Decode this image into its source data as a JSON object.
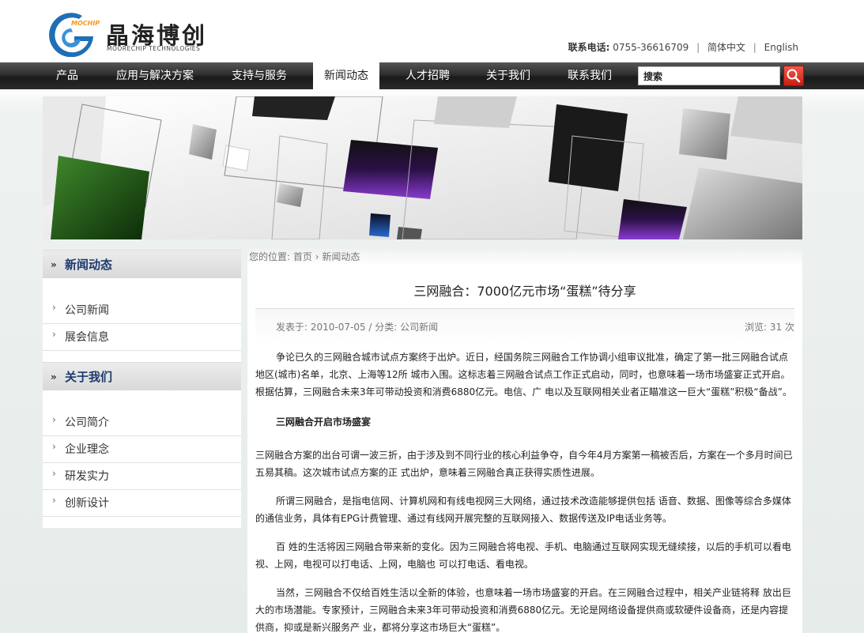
{
  "header": {
    "logo_cn": "晶海博创",
    "logo_en": "MOORECHIP TECHNOLOGIES",
    "logo_badge": "MOCHIP",
    "phone_label": "联系电话:",
    "phone": "0755-36616709",
    "lang_cn": "简体中文",
    "lang_en": "English"
  },
  "nav": {
    "items": [
      "产品",
      "应用与解决方案",
      "支持与服务",
      "新闻动态",
      "人才招聘",
      "关于我们",
      "联系我们"
    ],
    "active": "新闻动态",
    "search_value": "搜索"
  },
  "sidebar": {
    "sections": [
      {
        "title": "新闻动态",
        "items": [
          "公司新闻",
          "展会信息"
        ]
      },
      {
        "title": "关于我们",
        "items": [
          "公司简介",
          "企业理念",
          "研发实力",
          "创新设计"
        ]
      }
    ]
  },
  "breadcrumb": {
    "prefix": "您的位置:",
    "home": "首页",
    "current": "新闻动态"
  },
  "article": {
    "title": "三网融合：7000亿元市场“蛋糕”待分享",
    "meta_left": "发表于: 2010-07-05 / 分类: 公司新闻",
    "meta_right": "浏览: 31 次",
    "p1": "争论已久的三网融合城市试点方案终于出炉。近日，经国务院三网融合工作协调小组审议批准，确定了第一批三网融合试点地区(城市)名单，北京、上海等12所 城市入围。这标志着三网融合试点工作正式启动，同时，也意味着一场市场盛宴正式开启。根据估算，三网融合未来3年可带动投资和消费6880亿元。电信、广 电以及互联网相关业者正瞄准这一巨大“蛋糕”积极“备战”。",
    "heading": "三网融合开启市场盛宴",
    "p2": "三网融合方案的出台可谓一波三折，由于涉及到不同行业的核心利益争夺，自今年4月方案第一稿被否后，方案在一个多月时间已五易其稿。这次城市试点方案的正 式出炉，意味着三网融合真正获得实质性进展。",
    "p3": "所谓三网融合，是指电信网、计算机网和有线电视网三大网络，通过技术改造能够提供包括 语音、数据、图像等综合多媒体的通信业务，具体有EPG计费管理、通过有线网开展完整的互联网接入、数据传送及IP电话业务等。",
    "p4": "百 姓的生活将因三网融合带来新的变化。因为三网融合将电视、手机、电脑通过互联网实现无缝续接，以后的手机可以看电视、上网，电视可以打电话、上网，电脑也 可以打电话、看电视。",
    "p5": "当然，三网融合不仅给百姓生活以全新的体验，也意味着一场市场盛宴的开启。在三网融合过程中，相关产业链将释 放出巨大的市场潜能。专家预计，三网融合未来3年可带动投资和消费6880亿元。无论是网络设备提供商或软硬件设备商，还是内容提供商，抑或是新兴服务产 业，都将分享这市场巨大“蛋糕”。"
  },
  "colors": {
    "nav_bg": "#2a2a2a",
    "sidebar_title": "#1d3a6e",
    "search_button": "#d92a1a",
    "logo_accent": "#f39a1e"
  }
}
